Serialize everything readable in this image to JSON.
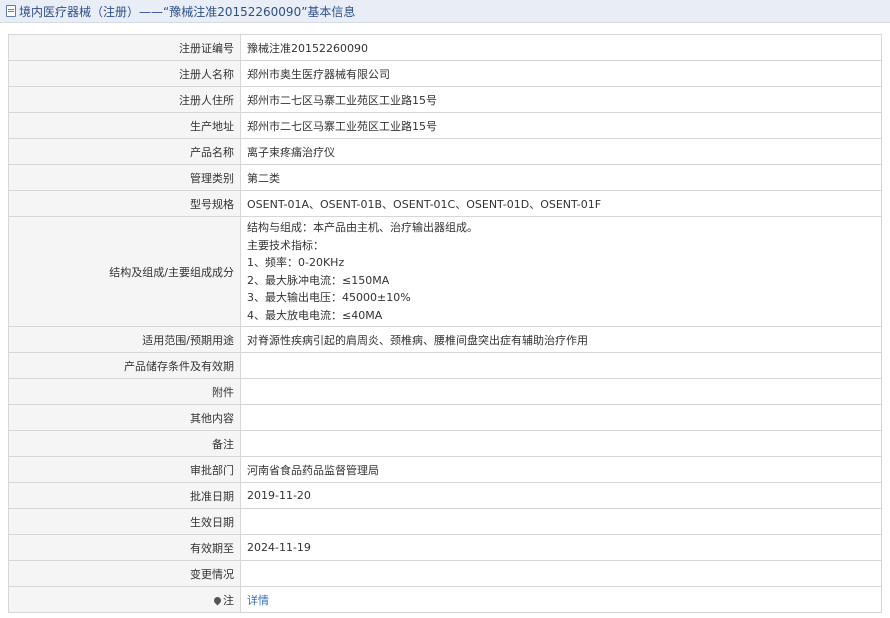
{
  "header": {
    "title": "境内医疗器械（注册）——“豫械注准20152260090”基本信息",
    "icon": "document-icon"
  },
  "rows": [
    {
      "label": "注册证编号",
      "value": "豫械注准20152260090"
    },
    {
      "label": "注册人名称",
      "value": "郑州市奥生医疗器械有限公司"
    },
    {
      "label": "注册人住所",
      "value": "郑州市二七区马寨工业苑区工业路15号"
    },
    {
      "label": "生产地址",
      "value": "郑州市二七区马寨工业苑区工业路15号"
    },
    {
      "label": "产品名称",
      "value": "离子束疼痛治疗仪"
    },
    {
      "label": "管理类别",
      "value": "第二类"
    },
    {
      "label": "型号规格",
      "value": "OSENT-01A、OSENT-01B、OSENT-01C、OSENT-01D、OSENT-01F"
    },
    {
      "label": "结构及组成/主要组成成分",
      "lines": [
        "结构与组成：本产品由主机、治疗输出器组成。",
        "主要技术指标：",
        "1、频率：0-20KHz",
        "2、最大脉冲电流：≤150MA",
        "3、最大输出电压：45000±10%",
        "4、最大放电电流：≤40MA"
      ]
    },
    {
      "label": "适用范围/预期用途",
      "value": "对脊源性疾病引起的肩周炎、颈椎病、腰椎间盘突出症有辅助治疗作用"
    },
    {
      "label": "产品储存条件及有效期",
      "value": ""
    },
    {
      "label": "附件",
      "value": ""
    },
    {
      "label": "其他内容",
      "value": ""
    },
    {
      "label": "备注",
      "value": ""
    },
    {
      "label": "审批部门",
      "value": "河南省食品药品监督管理局"
    },
    {
      "label": "批准日期",
      "value": "2019-11-20"
    },
    {
      "label": "生效日期",
      "value": ""
    },
    {
      "label": "有效期至",
      "value": "2024-11-19"
    },
    {
      "label": "变更情况",
      "value": ""
    },
    {
      "label": "注",
      "value": "详情",
      "icon": "pin-icon"
    }
  ],
  "colors": {
    "link": "#2f6fbb",
    "header_bg": "#e9edf5",
    "label_bg": "#f5f5f5"
  }
}
